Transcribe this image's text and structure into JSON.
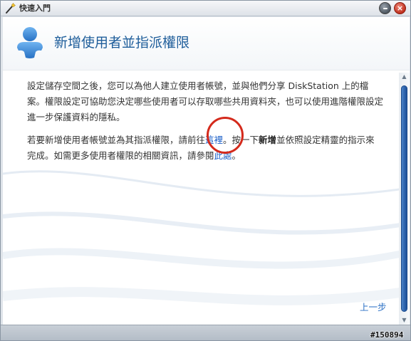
{
  "window": {
    "title": "快速入門"
  },
  "header": {
    "title": "新增使用者並指派權限"
  },
  "body": {
    "paragraph1": "設定儲存空間之後，您可以為他人建立使用者帳號，並與他們分享 DiskStation 上的檔案。權限設定可協助您決定哪些使用者可以存取哪些共用資料夾，也可以使用進階權限設定進一步保護資料的隱私。",
    "p2_part1": "若要新增使用者帳號並為其指派權限，請前往",
    "p2_link_here": "這裡",
    "p2_part2": "。按一下",
    "p2_bold_create": "新增",
    "p2_part3": "並依照設定精靈的指示來完成。如需更多使用者權限的相關資訊，請參閱",
    "p2_link_this": "此處",
    "p2_part4": "。"
  },
  "footer": {
    "back_label": "上一步"
  },
  "watermark": "#150894",
  "icons": {
    "title": "magic-wand-icon",
    "header": "user-icon",
    "minimize": "minimize-icon",
    "close": "close-icon"
  },
  "colors": {
    "accent": "#1e5d9a",
    "link": "#1f62c9",
    "annotation": "#d42a1c",
    "close": "#c0301e"
  }
}
